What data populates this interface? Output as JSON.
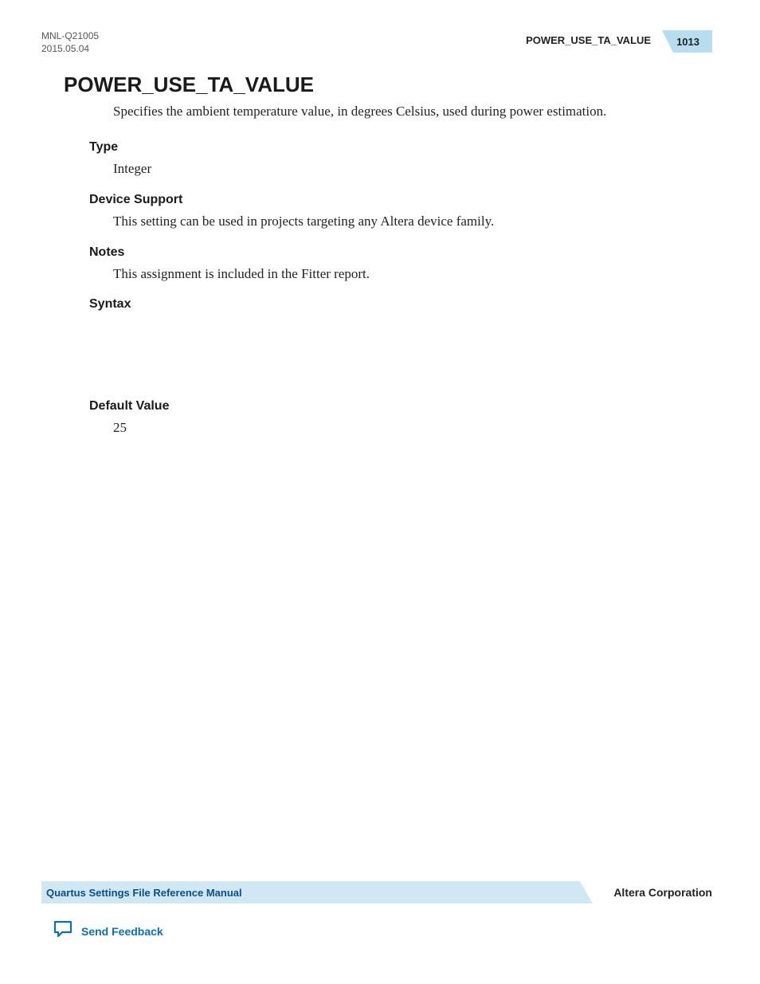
{
  "meta": {
    "doc_id": "MNL-Q21005",
    "date": "2015.05.04"
  },
  "header": {
    "topic": "POWER_USE_TA_VALUE",
    "page_number": "1013"
  },
  "title": "POWER_USE_TA_VALUE",
  "description": "Specifies the ambient temperature value, in degrees Celsius, used during power estimation.",
  "sections": {
    "type_label": "Type",
    "type_value": "Integer",
    "device_support_label": "Device Support",
    "device_support_value": "This setting can be used in projects targeting any Altera device family.",
    "notes_label": "Notes",
    "notes_value": "This assignment is included in the Fitter report.",
    "syntax_label": "Syntax",
    "default_value_label": "Default Value",
    "default_value_value": "25"
  },
  "footer": {
    "manual_title": "Quartus Settings File Reference Manual",
    "company": "Altera Corporation",
    "feedback": "Send Feedback"
  }
}
